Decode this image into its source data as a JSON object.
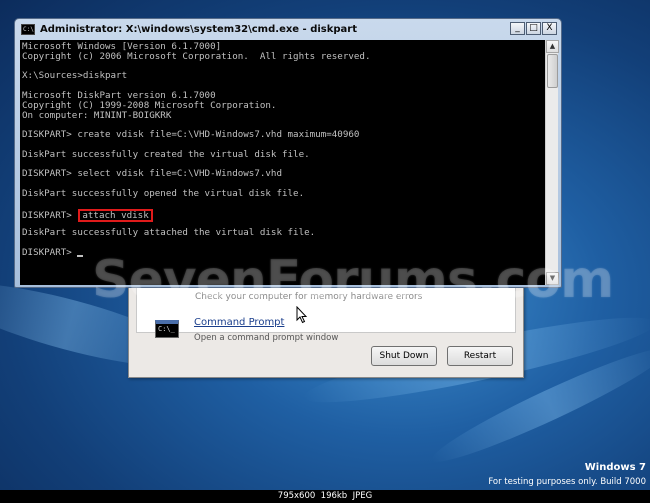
{
  "cmd_window": {
    "title": "Administrator: X:\\windows\\system32\\cmd.exe - diskpart",
    "icon": "cmd-icon",
    "buttons": {
      "minimize": "_",
      "maximize": "□",
      "close": "X"
    },
    "lines": [
      "Microsoft Windows [Version 6.1.7000]",
      "Copyright (c) 2006 Microsoft Corporation.  All rights reserved.",
      "",
      "X:\\Sources>diskpart",
      "",
      "Microsoft DiskPart version 6.1.7000",
      "Copyright (C) 1999-2008 Microsoft Corporation.",
      "On computer: MININT-BOIGKRK",
      "",
      "DISKPART> create vdisk file=C:\\VHD-Windows7.vhd maximum=40960",
      "",
      "DiskPart successfully created the virtual disk file.",
      "",
      "DISKPART> select vdisk file=C:\\VHD-Windows7.vhd",
      "",
      "DiskPart successfully opened the virtual disk file.",
      "",
      "",
      "",
      "DiskPart successfully attached the virtual disk file.",
      ""
    ],
    "highlighted_prompt": "DISKPART>",
    "highlighted_command": "attach vdisk",
    "final_prompt": "DISKPART>",
    "highlight_color": "#e01b1b"
  },
  "options_dialog": {
    "memory_option_partial": "Check your computer for memory hardware errors",
    "command_prompt_link": "Command Prompt",
    "command_prompt_desc": "Open a command prompt window",
    "cmd_icon_text": "C:\\_",
    "shutdown_label": "Shut Down",
    "restart_label": "Restart"
  },
  "watermark": "SevenForums.com",
  "branding": {
    "os_name": "Windows 7",
    "build_text": "For testing purposes only. Build 7000"
  },
  "info_bar": "795x600  196kb  JPEG"
}
